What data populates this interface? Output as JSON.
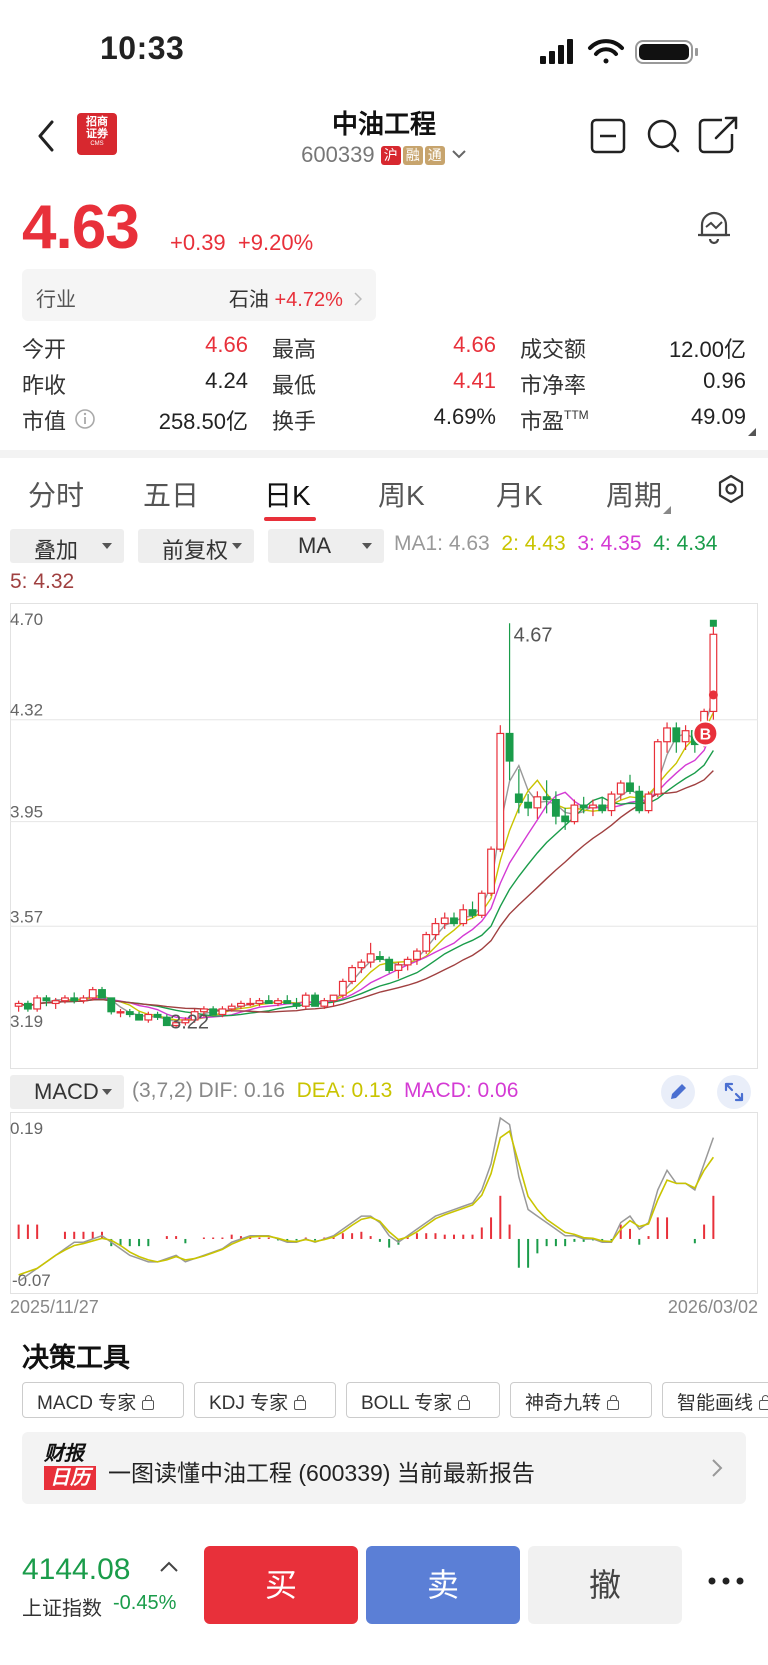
{
  "status_bar": {
    "time": "10:33"
  },
  "header": {
    "broker_logo": {
      "line1": "招商",
      "line2": "证券",
      "line3": "CMS"
    },
    "stock_name": "中油工程",
    "stock_code": "600339",
    "tags": [
      "沪",
      "融",
      "通"
    ]
  },
  "quote": {
    "price": "4.63",
    "change": "+0.39",
    "change_pct": "+9.20%",
    "industry_label": "行业",
    "industry_name": "石油",
    "industry_change": "+4.72%"
  },
  "stats": {
    "open_label": "今开",
    "open": "4.66",
    "high_label": "最高",
    "high": "4.66",
    "turnover_amount_label": "成交额",
    "turnover_amount": "12.00亿",
    "prev_close_label": "昨收",
    "prev_close": "4.24",
    "low_label": "最低",
    "low": "4.41",
    "pb_label": "市净率",
    "pb": "0.96",
    "mkt_cap_label": "市值",
    "mkt_cap": "258.50亿",
    "turnover_rate_label": "换手",
    "turnover_rate": "4.69%",
    "pe_label": "市盈",
    "pe_sup": "TTM",
    "pe": "49.09"
  },
  "tabs": [
    "分时",
    "五日",
    "日K",
    "周K",
    "月K",
    "周期"
  ],
  "active_tab": "日K",
  "controls": {
    "overlay": "叠加",
    "adjust": "前复权",
    "indicator": "MA",
    "macd": "MACD"
  },
  "ma_legend": {
    "ma1": "MA1: 4.63",
    "ma2": "2: 4.43",
    "ma3": "3: 4.35",
    "ma4": "4: 4.34",
    "ma5": "5: 4.32",
    "colors": {
      "ma1": "#999999",
      "ma2": "#c9c400",
      "ma3": "#d43ad4",
      "ma4": "#1a9c4a",
      "ma5": "#a04040"
    }
  },
  "macd_legend": {
    "params": "(3,7,2)",
    "dif": "DIF: 0.16",
    "dea": "DEA: 0.13",
    "macd": "MACD: 0.06"
  },
  "chart_data": [
    {
      "type": "candlestick",
      "y_ticks": [
        "4.70",
        "4.32",
        "3.95",
        "3.57",
        "3.19"
      ],
      "ylim": [
        3.19,
        4.7
      ],
      "annotations": {
        "max": "4.67",
        "min": "3.22",
        "marker": "B"
      },
      "ohlc": [
        [
          3.28,
          3.3,
          3.26,
          3.29
        ],
        [
          3.29,
          3.3,
          3.26,
          3.27
        ],
        [
          3.27,
          3.32,
          3.26,
          3.31
        ],
        [
          3.31,
          3.32,
          3.28,
          3.3
        ],
        [
          3.29,
          3.31,
          3.27,
          3.3
        ],
        [
          3.3,
          3.32,
          3.29,
          3.31
        ],
        [
          3.31,
          3.33,
          3.29,
          3.3
        ],
        [
          3.3,
          3.32,
          3.29,
          3.31
        ],
        [
          3.31,
          3.35,
          3.3,
          3.34
        ],
        [
          3.34,
          3.35,
          3.31,
          3.31
        ],
        [
          3.31,
          3.31,
          3.25,
          3.26
        ],
        [
          3.26,
          3.27,
          3.24,
          3.26
        ],
        [
          3.26,
          3.27,
          3.24,
          3.25
        ],
        [
          3.25,
          3.26,
          3.23,
          3.23
        ],
        [
          3.23,
          3.26,
          3.22,
          3.25
        ],
        [
          3.25,
          3.26,
          3.23,
          3.24
        ],
        [
          3.24,
          3.25,
          3.21,
          3.21
        ],
        [
          3.21,
          3.23,
          3.2,
          3.22
        ],
        [
          3.22,
          3.24,
          3.21,
          3.23
        ],
        [
          3.23,
          3.27,
          3.22,
          3.26
        ],
        [
          3.26,
          3.28,
          3.24,
          3.27
        ],
        [
          3.27,
          3.28,
          3.25,
          3.25
        ],
        [
          3.25,
          3.28,
          3.24,
          3.27
        ],
        [
          3.27,
          3.29,
          3.26,
          3.28
        ],
        [
          3.28,
          3.3,
          3.27,
          3.29
        ],
        [
          3.29,
          3.31,
          3.28,
          3.29
        ],
        [
          3.29,
          3.31,
          3.28,
          3.3
        ],
        [
          3.3,
          3.32,
          3.29,
          3.29
        ],
        [
          3.29,
          3.31,
          3.28,
          3.3
        ],
        [
          3.3,
          3.32,
          3.29,
          3.29
        ],
        [
          3.29,
          3.31,
          3.27,
          3.28
        ],
        [
          3.28,
          3.33,
          3.27,
          3.32
        ],
        [
          3.32,
          3.33,
          3.28,
          3.28
        ],
        [
          3.28,
          3.31,
          3.27,
          3.3
        ],
        [
          3.3,
          3.32,
          3.28,
          3.32
        ],
        [
          3.32,
          3.38,
          3.31,
          3.37
        ],
        [
          3.37,
          3.43,
          3.36,
          3.42
        ],
        [
          3.42,
          3.45,
          3.4,
          3.44
        ],
        [
          3.44,
          3.51,
          3.42,
          3.47
        ],
        [
          3.46,
          3.48,
          3.44,
          3.45
        ],
        [
          3.45,
          3.46,
          3.4,
          3.41
        ],
        [
          3.41,
          3.44,
          3.38,
          3.43
        ],
        [
          3.43,
          3.46,
          3.41,
          3.45
        ],
        [
          3.45,
          3.49,
          3.43,
          3.48
        ],
        [
          3.48,
          3.55,
          3.47,
          3.54
        ],
        [
          3.54,
          3.6,
          3.52,
          3.58
        ],
        [
          3.58,
          3.62,
          3.56,
          3.6
        ],
        [
          3.6,
          3.62,
          3.57,
          3.58
        ],
        [
          3.58,
          3.65,
          3.57,
          3.63
        ],
        [
          3.63,
          3.66,
          3.6,
          3.61
        ],
        [
          3.61,
          3.7,
          3.6,
          3.69
        ],
        [
          3.69,
          3.86,
          3.68,
          3.85
        ],
        [
          3.85,
          4.3,
          3.84,
          4.27
        ],
        [
          4.27,
          4.67,
          4.1,
          4.17
        ],
        [
          4.05,
          4.14,
          3.98,
          4.02
        ],
        [
          4.02,
          4.05,
          3.97,
          4.0
        ],
        [
          4.0,
          4.06,
          3.96,
          4.04
        ],
        [
          4.04,
          4.1,
          3.98,
          4.03
        ],
        [
          4.03,
          4.06,
          3.94,
          3.97
        ],
        [
          3.97,
          4.0,
          3.92,
          3.95
        ],
        [
          3.95,
          4.03,
          3.94,
          4.01
        ],
        [
          4.01,
          4.04,
          3.98,
          4.0
        ],
        [
          4.0,
          4.03,
          3.97,
          4.01
        ],
        [
          4.01,
          4.04,
          3.98,
          3.99
        ],
        [
          3.99,
          4.06,
          3.97,
          4.05
        ],
        [
          4.05,
          4.1,
          4.03,
          4.09
        ],
        [
          4.09,
          4.12,
          4.05,
          4.06
        ],
        [
          4.06,
          4.08,
          3.98,
          3.99
        ],
        [
          3.99,
          4.06,
          3.98,
          4.05
        ],
        [
          4.05,
          4.25,
          4.04,
          4.24
        ],
        [
          4.24,
          4.31,
          4.2,
          4.29
        ],
        [
          4.29,
          4.31,
          4.2,
          4.24
        ],
        [
          4.24,
          4.3,
          4.21,
          4.28
        ],
        [
          4.28,
          4.29,
          4.2,
          4.23
        ],
        [
          4.23,
          4.36,
          4.22,
          4.35
        ],
        [
          4.35,
          4.67,
          4.32,
          4.63
        ]
      ]
    },
    {
      "type": "macd",
      "y_ticks": [
        "0.19",
        "-0.07"
      ],
      "ylim": [
        -0.07,
        0.19
      ],
      "x_labels": [
        "2025/11/27",
        "2026/03/02"
      ],
      "dif": [
        -0.06,
        -0.05,
        -0.04,
        -0.03,
        -0.02,
        -0.01,
        0.0,
        0.0,
        0.005,
        0.01,
        0.0,
        -0.01,
        -0.02,
        -0.025,
        -0.03,
        -0.03,
        -0.025,
        -0.02,
        -0.03,
        -0.025,
        -0.02,
        -0.015,
        -0.01,
        0.0,
        0.005,
        0.01,
        0.01,
        0.01,
        0.005,
        0.0,
        0.0,
        0.005,
        0.0,
        0.005,
        0.01,
        0.02,
        0.03,
        0.04,
        0.04,
        0.03,
        0.01,
        0.0,
        0.01,
        0.02,
        0.03,
        0.04,
        0.045,
        0.05,
        0.055,
        0.06,
        0.08,
        0.12,
        0.19,
        0.18,
        0.1,
        0.05,
        0.04,
        0.03,
        0.02,
        0.01,
        0.01,
        0.005,
        0.005,
        0.0,
        0.0,
        0.03,
        0.04,
        0.02,
        0.03,
        0.08,
        0.11,
        0.09,
        0.09,
        0.08,
        0.12,
        0.16
      ],
      "dea": [
        -0.05,
        -0.045,
        -0.04,
        -0.03,
        -0.02,
        -0.012,
        -0.005,
        -0.002,
        0.002,
        0.006,
        0.003,
        -0.005,
        -0.015,
        -0.022,
        -0.027,
        -0.03,
        -0.027,
        -0.022,
        -0.027,
        -0.025,
        -0.021,
        -0.016,
        -0.011,
        -0.003,
        0.003,
        0.008,
        0.009,
        0.009,
        0.006,
        0.002,
        0.001,
        0.004,
        0.001,
        0.004,
        0.008,
        0.016,
        0.026,
        0.035,
        0.038,
        0.032,
        0.016,
        0.004,
        0.008,
        0.016,
        0.026,
        0.036,
        0.042,
        0.047,
        0.052,
        0.057,
        0.072,
        0.105,
        0.16,
        0.17,
        0.12,
        0.07,
        0.05,
        0.035,
        0.025,
        0.015,
        0.012,
        0.007,
        0.006,
        0.002,
        0.001,
        0.02,
        0.033,
        0.024,
        0.028,
        0.065,
        0.095,
        0.09,
        0.09,
        0.083,
        0.11,
        0.13
      ],
      "macd": [
        0.01,
        0.01,
        0.01,
        0.0,
        0.0,
        0.005,
        0.005,
        0.005,
        0.005,
        0.005,
        -0.005,
        -0.005,
        -0.005,
        -0.005,
        -0.005,
        0.0,
        0.002,
        0.002,
        -0.003,
        0.0,
        0.001,
        0.001,
        0.001,
        0.003,
        0.002,
        0.002,
        0.001,
        0.001,
        -0.001,
        -0.002,
        -0.001,
        0.001,
        -0.001,
        0.001,
        0.002,
        0.004,
        0.004,
        0.005,
        0.002,
        -0.002,
        -0.006,
        -0.004,
        0.002,
        0.004,
        0.004,
        0.004,
        0.003,
        0.003,
        0.003,
        0.003,
        0.008,
        0.015,
        0.03,
        0.01,
        -0.02,
        -0.02,
        -0.01,
        -0.005,
        -0.005,
        -0.005,
        -0.002,
        -0.002,
        -0.001,
        -0.002,
        -0.001,
        0.01,
        0.007,
        -0.004,
        0.002,
        0.015,
        0.015,
        0.0,
        0.0,
        -0.003,
        0.01,
        0.03
      ]
    }
  ],
  "tools": {
    "title": "决策工具",
    "items": [
      "MACD 专家",
      "KDJ 专家",
      "BOLL 专家",
      "神奇九转",
      "智能画线"
    ]
  },
  "report": {
    "logo_line1": "财报",
    "logo_line2": "日历",
    "text": "一图读懂中油工程 (600339) 当前最新报告"
  },
  "bottom": {
    "index_value": "4144.08",
    "index_name": "上证指数",
    "index_change": "-0.45%",
    "buy": "买",
    "sell": "卖",
    "cancel": "撤"
  }
}
